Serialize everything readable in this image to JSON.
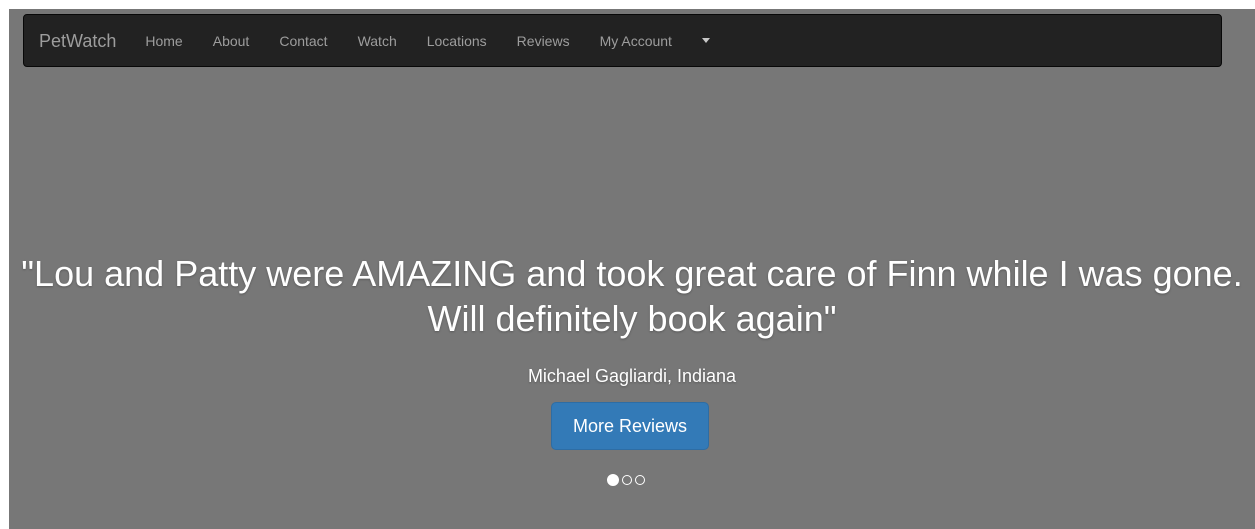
{
  "navbar": {
    "brand": "PetWatch",
    "items": [
      {
        "label": "Home"
      },
      {
        "label": "About"
      },
      {
        "label": "Contact"
      },
      {
        "label": "Watch"
      },
      {
        "label": "Locations"
      },
      {
        "label": "Reviews"
      },
      {
        "label": "My Account"
      }
    ],
    "dropdown_icon": "caret-down-icon"
  },
  "carousel": {
    "quote": "\"Lou and Patty were AMAZING and took great care of Finn while I was gone. Will definitely book again\"",
    "author": "Michael Gagliardi, Indiana",
    "button_label": "More Reviews",
    "slide_count": 3,
    "active_slide": 1
  },
  "colors": {
    "hero_background": "#777777",
    "navbar_background": "#222222",
    "button_primary": "#337ab7"
  }
}
